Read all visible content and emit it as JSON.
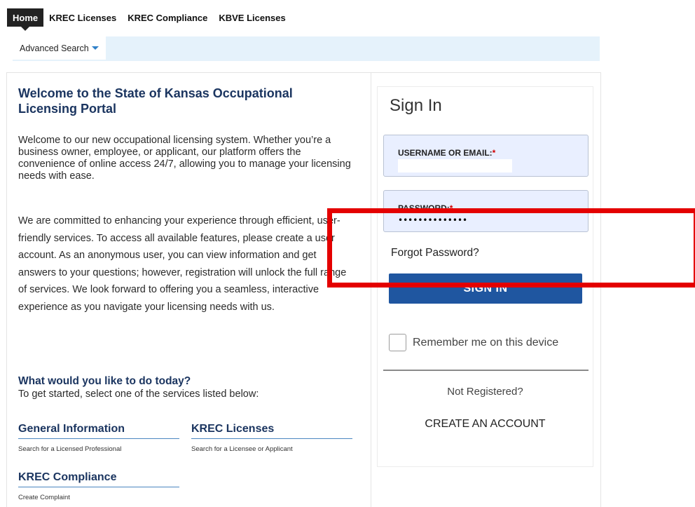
{
  "topnav": {
    "tabs": [
      {
        "label": "Home",
        "active": true
      },
      {
        "label": "KREC Licenses",
        "active": false
      },
      {
        "label": "KREC Compliance",
        "active": false
      },
      {
        "label": "KBVE Licenses",
        "active": false
      }
    ]
  },
  "subnav": {
    "advanced_search_label": "Advanced Search"
  },
  "welcome": {
    "title": "Welcome to the State of Kansas Occupational Licensing Portal",
    "intro": "Welcome to our new occupational licensing system. Whether you’re a business owner, employee, or applicant, our platform offers the convenience of online access 24/7, allowing you to manage your licensing needs with ease.",
    "commitment": "We are committed to enhancing your experience through efficient, user-friendly services. To access all available features, please create a user account. As an anonymous user, you can view information and get answers to your questions; however, registration will unlock the full range of services. We look forward to offering you a seamless, interactive experience as you navigate your licensing needs with us."
  },
  "todo": {
    "title": "What would you like to do today?",
    "subtitle": "To get started, select one of the services listed below:",
    "services": [
      {
        "title": "General Information",
        "description": "Search for a Licensed Professional"
      },
      {
        "title": "KREC Licenses",
        "description": "Search for a Licensee or Applicant"
      },
      {
        "title": "KREC Compliance",
        "description": "Create Complaint"
      }
    ]
  },
  "signin": {
    "title": "Sign In",
    "username_label": "USERNAME OR EMAIL:",
    "password_label": "PASSWORD:",
    "required_marker": "*",
    "username_value": "",
    "password_value": "••••••••••••••",
    "forgot_label": "Forgot Password?",
    "button_label": "SIGN IN",
    "remember_label": "Remember me on this device",
    "remember_checked": false,
    "not_registered_label": "Not Registered?",
    "create_account_label": "CREATE AN ACCOUNT"
  },
  "colors": {
    "heading": "#1b3560",
    "button": "#1f56a0",
    "subnav_bg": "#e5f2fb",
    "field_bg": "#e9efff",
    "annotation": "#e40000"
  }
}
